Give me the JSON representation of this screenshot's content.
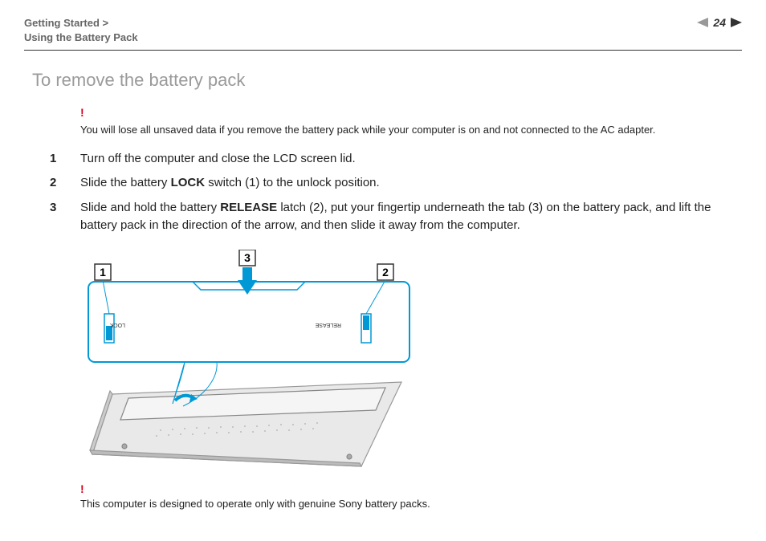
{
  "breadcrumb": {
    "line1": "Getting Started >",
    "line2": "Using the Battery Pack"
  },
  "page_number": "24",
  "title": "To remove the battery pack",
  "warn_mark": "!",
  "warning_top": "You will lose all unsaved data if you remove the battery pack while your computer is on and not connected to the AC adapter.",
  "steps": {
    "s1_a": "Turn off the computer and close the LCD screen lid.",
    "s2_a": "Slide the battery ",
    "s2_b": "LOCK",
    "s2_c": " switch (1) to the unlock position.",
    "s3_a": "Slide and hold the battery ",
    "s3_b": "RELEASE",
    "s3_c": " latch (2), put your fingertip underneath the tab (3) on the battery pack, and lift the battery pack in the direction of the arrow, and then slide it away from the computer."
  },
  "diagram": {
    "callout_1": "1",
    "callout_2": "2",
    "callout_3": "3",
    "label_lock": "LOCK",
    "label_release": "RELEASE"
  },
  "warning_bottom": "This computer is designed to operate only with genuine Sony battery packs."
}
